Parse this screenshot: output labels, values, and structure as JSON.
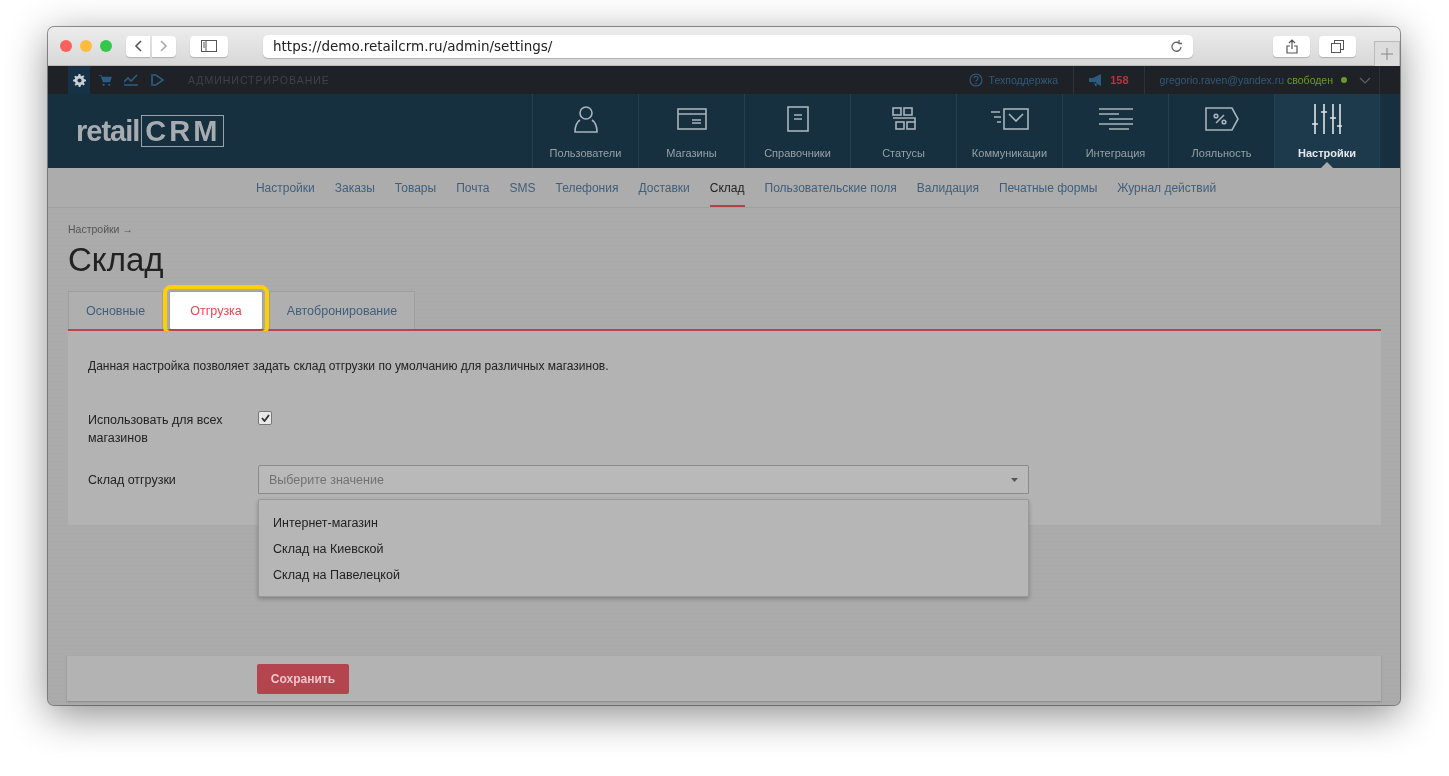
{
  "browser": {
    "url": "https://demo.retailcrm.ru/admin/settings/"
  },
  "topbar": {
    "apps": [
      {
        "selected": true
      },
      {
        "selected": false
      },
      {
        "selected": false
      },
      {
        "selected": false
      }
    ],
    "section": "АДМИНИСТРИРОВАНИЕ",
    "support": "Техподдержка",
    "notifications": "158",
    "user_email": "gregorio.raven@yandex.ru",
    "user_status": "свободен"
  },
  "header": {
    "logo": {
      "word": "retail",
      "letters": "CRM"
    },
    "nav": [
      {
        "label": "Пользователи",
        "selected": false
      },
      {
        "label": "Магазины",
        "selected": false
      },
      {
        "label": "Справочники",
        "selected": false
      },
      {
        "label": "Статусы",
        "selected": false
      },
      {
        "label": "Коммуникации",
        "selected": false
      },
      {
        "label": "Интеграция",
        "selected": false
      },
      {
        "label": "Лояльность",
        "selected": false
      },
      {
        "label": "Настройки",
        "selected": true
      }
    ]
  },
  "subnav": [
    {
      "label": "Настройки",
      "selected": false
    },
    {
      "label": "Заказы",
      "selected": false
    },
    {
      "label": "Товары",
      "selected": false
    },
    {
      "label": "Почта",
      "selected": false
    },
    {
      "label": "SMS",
      "selected": false
    },
    {
      "label": "Телефония",
      "selected": false
    },
    {
      "label": "Доставки",
      "selected": false
    },
    {
      "label": "Склад",
      "selected": true
    },
    {
      "label": "Пользовательские поля",
      "selected": false
    },
    {
      "label": "Валидация",
      "selected": false
    },
    {
      "label": "Печатные формы",
      "selected": false
    },
    {
      "label": "Журнал действий",
      "selected": false
    }
  ],
  "breadcrumb": "Настройки →",
  "title": "Склад",
  "tabs": [
    {
      "label": "Основные",
      "selected": false,
      "highlighted": false
    },
    {
      "label": "Отгрузка",
      "selected": true,
      "highlighted": true
    },
    {
      "label": "Автобронирование",
      "selected": false,
      "highlighted": false
    }
  ],
  "description": "Данная настройка позволяет задать склад отгрузки по умолчанию для различных магазинов.",
  "fields": [
    {
      "kind": "checkbox",
      "label": "Использовать для всех магазинов",
      "checked": true
    },
    {
      "kind": "select",
      "label": "Склад отгрузки",
      "placeholder": "Выберите значение",
      "expanded": true,
      "options": [
        "Интернет-магазин",
        "Склад на Киевской",
        "Склад на Павелецкой"
      ]
    }
  ],
  "save_button": "Сохранить"
}
